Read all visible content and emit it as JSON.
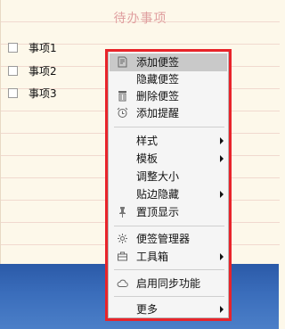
{
  "note": {
    "title": "待办事项",
    "items": [
      "事项1",
      "事项2",
      "事项3"
    ]
  },
  "menu": {
    "items": [
      {
        "label": "添加便签",
        "icon": "note-add-icon",
        "selected": true
      },
      {
        "label": "隐藏便签"
      },
      {
        "label": "删除便签",
        "icon": "trash-icon"
      },
      {
        "label": "添加提醒",
        "icon": "alarm-clock-icon"
      },
      {
        "label": "样式",
        "submenu": true
      },
      {
        "label": "模板",
        "submenu": true
      },
      {
        "label": "调整大小"
      },
      {
        "label": "贴边隐藏",
        "submenu": true
      },
      {
        "label": "置顶显示",
        "icon": "pin-icon"
      },
      {
        "label": "便签管理器",
        "icon": "gear-icon"
      },
      {
        "label": "工具箱",
        "icon": "toolbox-icon",
        "submenu": true
      },
      {
        "label": "启用同步功能",
        "icon": "cloud-icon"
      },
      {
        "label": "更多",
        "submenu": true
      }
    ]
  },
  "colors": {
    "highlight_frame": "#e8242a",
    "title": "#e0a0a0",
    "selected_bg": "#c9c9c9"
  }
}
